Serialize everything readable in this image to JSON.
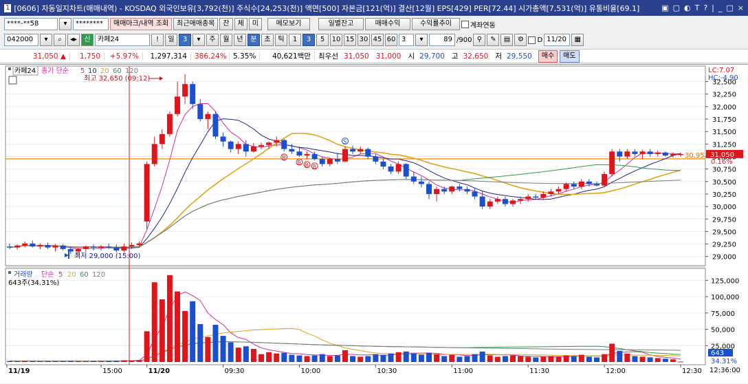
{
  "window": {
    "number": "1",
    "title": "[0606] 자동일지차트(매매내역) - KOSDAQ 외국인보유[3,792(천)] 주식수[24,253(천)] 액면[500] 자본금[121(억)] 결산[12월] EPS[429] PER[72.44] 시가총액[7,531(억)] 유통비율[69.1]",
    "controls": [
      "▣",
      "▢",
      "◐",
      "T",
      "?",
      "|",
      "_",
      "□",
      "×"
    ]
  },
  "toolbar1": {
    "account": "****-**58",
    "password": "********",
    "mark_button": "매매마크/내역 조회",
    "recent_button": "최근매매종목",
    "jan": "잔",
    "che": "체",
    "mi": "미",
    "memo_button": "메모보기",
    "daily_balance_button": "일별잔고",
    "trade_profit_button": "매매수익",
    "profit_trend_button": "수익률추이",
    "account_link_label": "계좌연동"
  },
  "toolbar2": {
    "code": "042000",
    "sin_badge": "신",
    "stock_name": "카페24",
    "excl": "!",
    "period_day": "일",
    "day_count": "3",
    "week": "주",
    "month": "월",
    "year": "년",
    "minute": "분",
    "tick": "초",
    "tick2": "틱",
    "intervals": [
      "1",
      "3",
      "5",
      "10",
      "15",
      "30",
      "45",
      "60"
    ],
    "interval_selected": "3",
    "interval_value": "3",
    "count_value": "89",
    "count_total": "/900",
    "d_label": "D",
    "date_value": "11/20"
  },
  "quote": {
    "price": "31,050",
    "arrow": "▲",
    "change": "1,750",
    "change_pct": "+5.97%",
    "volume": "1,297,314",
    "vol_ratio": "386.24%",
    "turnover": "5.35%",
    "amount": "40,621백만",
    "best_label": "최우선",
    "ask": "31,050",
    "bid": "31,000",
    "open_label": "시",
    "open": "29,700",
    "high_label": "고",
    "high": "32,650",
    "low_label": "저",
    "low": "29,550",
    "buy_button": "매수",
    "sell_button": "매도"
  },
  "price_panel": {
    "stock_label": "카페24",
    "ma_title": "종가 단순",
    "ma_periods": [
      "5",
      "10",
      "20",
      "60",
      "120"
    ],
    "ma_colors": [
      "#d0309a",
      "#23238c",
      "#e0a418",
      "#2e9a4e",
      "#7a7a7a"
    ],
    "lc_label": "LC:7.07",
    "hc_label": "HC:-4.90",
    "high_annotation": "최고 32,650 (09:12)",
    "low_annotation": "최저 29,000 (15:00)",
    "y_ticks": [
      "32,500",
      "32,250",
      "32,000",
      "31,750",
      "31,500",
      "31,250",
      "31,000",
      "30,750",
      "30,500",
      "30,250",
      "30,000",
      "29,750",
      "29,500",
      "29,250",
      "29,000"
    ],
    "ref_price_label": "30,953",
    "current_price_label": "31,050",
    "pct_label": "0.16%"
  },
  "volume_panel": {
    "title": "거래량",
    "ma_title": "단순",
    "ma_periods": [
      "5",
      "20",
      "60",
      "120"
    ],
    "current_label": "643주(34.31%)",
    "y_ticks": [
      "125,000",
      "100,000",
      "75,000",
      "50,000",
      "25,000"
    ],
    "current_value": "643",
    "current_pct": "34.31%"
  },
  "x_axis": {
    "labels": [
      "11/19",
      "15:00",
      "11/20",
      "09:30",
      "10:00",
      "10:30",
      "11:00",
      "11:30",
      "12:00",
      "12:30"
    ],
    "end_time": "12:36:00"
  },
  "colors": {
    "up": "#e0151b",
    "down": "#1a4fcf",
    "title_bar": "#2b3f8f",
    "ref_line": "#f08a00"
  },
  "chart_data": {
    "type": "candlestick",
    "price_ylim": [
      28900,
      32700
    ],
    "volume_ylim": [
      0,
      137000
    ],
    "candles": [
      {
        "o": 29200,
        "h": 29260,
        "l": 29150,
        "c": 29180,
        "v": 1500
      },
      {
        "o": 29180,
        "h": 29240,
        "l": 29140,
        "c": 29220,
        "v": 1200
      },
      {
        "o": 29220,
        "h": 29300,
        "l": 29180,
        "c": 29260,
        "v": 1800
      },
      {
        "o": 29260,
        "h": 29320,
        "l": 29180,
        "c": 29200,
        "v": 1300
      },
      {
        "o": 29200,
        "h": 29260,
        "l": 29150,
        "c": 29230,
        "v": 1100
      },
      {
        "o": 29230,
        "h": 29280,
        "l": 29150,
        "c": 29180,
        "v": 1500
      },
      {
        "o": 29180,
        "h": 29250,
        "l": 29100,
        "c": 29220,
        "v": 1200
      },
      {
        "o": 29220,
        "h": 29250,
        "l": 29120,
        "c": 29150,
        "v": 1400
      },
      {
        "o": 29150,
        "h": 29200,
        "l": 29050,
        "c": 29100,
        "v": 1600
      },
      {
        "o": 29100,
        "h": 29180,
        "l": 29000,
        "c": 29150,
        "v": 1300
      },
      {
        "o": 29150,
        "h": 29220,
        "l": 29100,
        "c": 29200,
        "v": 1200
      },
      {
        "o": 29200,
        "h": 29240,
        "l": 29120,
        "c": 29180,
        "v": 1400
      },
      {
        "o": 29180,
        "h": 29230,
        "l": 29120,
        "c": 29200,
        "v": 1500
      },
      {
        "o": 29200,
        "h": 29260,
        "l": 29150,
        "c": 29180,
        "v": 1700
      },
      {
        "o": 29180,
        "h": 29240,
        "l": 29080,
        "c": 29120,
        "v": 1900
      },
      {
        "o": 29120,
        "h": 29260,
        "l": 29080,
        "c": 29200,
        "v": 2600
      },
      {
        "o": 29200,
        "h": 29280,
        "l": 29150,
        "c": 29230,
        "v": 2300
      },
      {
        "o": 29230,
        "h": 29300,
        "l": 29180,
        "c": 29260,
        "v": 3000
      },
      {
        "o": 29700,
        "h": 30900,
        "l": 29550,
        "c": 30850,
        "v": 47000
      },
      {
        "o": 30850,
        "h": 31400,
        "l": 30800,
        "c": 31250,
        "v": 122000
      },
      {
        "o": 31250,
        "h": 31550,
        "l": 31150,
        "c": 31450,
        "v": 96000
      },
      {
        "o": 31450,
        "h": 31900,
        "l": 31400,
        "c": 31850,
        "v": 133000
      },
      {
        "o": 31850,
        "h": 32500,
        "l": 31800,
        "c": 32200,
        "v": 108000
      },
      {
        "o": 32200,
        "h": 32650,
        "l": 32050,
        "c": 32450,
        "v": 78000
      },
      {
        "o": 32450,
        "h": 32500,
        "l": 31950,
        "c": 32050,
        "v": 93000
      },
      {
        "o": 32050,
        "h": 32150,
        "l": 31700,
        "c": 31750,
        "v": 58000
      },
      {
        "o": 31750,
        "h": 31900,
        "l": 31550,
        "c": 31850,
        "v": 38000
      },
      {
        "o": 31850,
        "h": 31900,
        "l": 31350,
        "c": 31400,
        "v": 57000
      },
      {
        "o": 31400,
        "h": 31480,
        "l": 31200,
        "c": 31300,
        "v": 40000
      },
      {
        "o": 31300,
        "h": 31320,
        "l": 31080,
        "c": 31150,
        "v": 30000
      },
      {
        "o": 31150,
        "h": 31300,
        "l": 31050,
        "c": 31250,
        "v": 22000
      },
      {
        "o": 31250,
        "h": 31330,
        "l": 31000,
        "c": 31100,
        "v": 24000
      },
      {
        "o": 31100,
        "h": 31270,
        "l": 31080,
        "c": 31200,
        "v": 20000
      },
      {
        "o": 31200,
        "h": 31280,
        "l": 31150,
        "c": 31230,
        "v": 12000
      },
      {
        "o": 31230,
        "h": 31300,
        "l": 31150,
        "c": 31280,
        "v": 15000
      },
      {
        "o": 31280,
        "h": 31400,
        "l": 31200,
        "c": 31330,
        "v": 13000
      },
      {
        "o": 31330,
        "h": 31350,
        "l": 31100,
        "c": 31150,
        "v": 14000
      },
      {
        "o": 31150,
        "h": 31250,
        "l": 31050,
        "c": 31100,
        "v": 11000
      },
      {
        "o": 31100,
        "h": 31200,
        "l": 31000,
        "c": 31020,
        "v": 10000
      },
      {
        "o": 31020,
        "h": 31100,
        "l": 30950,
        "c": 31050,
        "v": 9000
      },
      {
        "o": 31050,
        "h": 31100,
        "l": 30920,
        "c": 30950,
        "v": 10000
      },
      {
        "o": 30950,
        "h": 31000,
        "l": 30800,
        "c": 30850,
        "v": 12000
      },
      {
        "o": 30850,
        "h": 30980,
        "l": 30800,
        "c": 30950,
        "v": 9000
      },
      {
        "o": 30950,
        "h": 31080,
        "l": 30850,
        "c": 30900,
        "v": 10000
      },
      {
        "o": 30900,
        "h": 31200,
        "l": 30880,
        "c": 31150,
        "v": 18000
      },
      {
        "o": 31150,
        "h": 31220,
        "l": 31050,
        "c": 31100,
        "v": 9000
      },
      {
        "o": 31100,
        "h": 31200,
        "l": 31050,
        "c": 31150,
        "v": 8000
      },
      {
        "o": 31150,
        "h": 31180,
        "l": 30950,
        "c": 31000,
        "v": 9000
      },
      {
        "o": 31000,
        "h": 31050,
        "l": 30850,
        "c": 30900,
        "v": 12000
      },
      {
        "o": 30900,
        "h": 30950,
        "l": 30750,
        "c": 30800,
        "v": 11000
      },
      {
        "o": 30800,
        "h": 30850,
        "l": 30650,
        "c": 30700,
        "v": 13000
      },
      {
        "o": 30700,
        "h": 30900,
        "l": 30650,
        "c": 30850,
        "v": 15000
      },
      {
        "o": 30850,
        "h": 30870,
        "l": 30550,
        "c": 30600,
        "v": 16000
      },
      {
        "o": 30600,
        "h": 30700,
        "l": 30450,
        "c": 30500,
        "v": 13000
      },
      {
        "o": 30500,
        "h": 30600,
        "l": 30380,
        "c": 30450,
        "v": 11000
      },
      {
        "o": 30450,
        "h": 30500,
        "l": 30150,
        "c": 30250,
        "v": 14000
      },
      {
        "o": 30250,
        "h": 30400,
        "l": 30100,
        "c": 30350,
        "v": 12000
      },
      {
        "o": 30350,
        "h": 30400,
        "l": 30250,
        "c": 30300,
        "v": 9000
      },
      {
        "o": 30300,
        "h": 30420,
        "l": 30250,
        "c": 30400,
        "v": 11000
      },
      {
        "o": 30400,
        "h": 30450,
        "l": 30300,
        "c": 30350,
        "v": 8000
      },
      {
        "o": 30350,
        "h": 30400,
        "l": 30250,
        "c": 30300,
        "v": 9000
      },
      {
        "o": 30300,
        "h": 30380,
        "l": 30150,
        "c": 30200,
        "v": 12000
      },
      {
        "o": 30200,
        "h": 30300,
        "l": 29950,
        "c": 30000,
        "v": 16000
      },
      {
        "o": 30000,
        "h": 30150,
        "l": 29950,
        "c": 30100,
        "v": 10000
      },
      {
        "o": 30100,
        "h": 30200,
        "l": 30050,
        "c": 30150,
        "v": 8000
      },
      {
        "o": 30150,
        "h": 30200,
        "l": 30000,
        "c": 30050,
        "v": 9000
      },
      {
        "o": 30050,
        "h": 30150,
        "l": 30000,
        "c": 30120,
        "v": 10000
      },
      {
        "o": 30120,
        "h": 30200,
        "l": 30050,
        "c": 30150,
        "v": 9000
      },
      {
        "o": 30150,
        "h": 30250,
        "l": 30100,
        "c": 30200,
        "v": 8000
      },
      {
        "o": 30200,
        "h": 30250,
        "l": 30150,
        "c": 30180,
        "v": 7000
      },
      {
        "o": 30180,
        "h": 30300,
        "l": 30150,
        "c": 30250,
        "v": 8000
      },
      {
        "o": 30250,
        "h": 30350,
        "l": 30200,
        "c": 30300,
        "v": 9000
      },
      {
        "o": 30300,
        "h": 30400,
        "l": 30250,
        "c": 30350,
        "v": 8000
      },
      {
        "o": 30350,
        "h": 30480,
        "l": 30300,
        "c": 30450,
        "v": 10000
      },
      {
        "o": 30450,
        "h": 30500,
        "l": 30350,
        "c": 30400,
        "v": 9000
      },
      {
        "o": 30400,
        "h": 30550,
        "l": 30350,
        "c": 30500,
        "v": 11000
      },
      {
        "o": 30500,
        "h": 30550,
        "l": 30400,
        "c": 30450,
        "v": 8000
      },
      {
        "o": 30450,
        "h": 30500,
        "l": 30400,
        "c": 30420,
        "v": 7000
      },
      {
        "o": 30420,
        "h": 30700,
        "l": 30400,
        "c": 30650,
        "v": 12000
      },
      {
        "o": 30650,
        "h": 31150,
        "l": 30600,
        "c": 31100,
        "v": 28000
      },
      {
        "o": 31100,
        "h": 31150,
        "l": 30900,
        "c": 31000,
        "v": 17000
      },
      {
        "o": 31000,
        "h": 31150,
        "l": 30950,
        "c": 31100,
        "v": 13000
      },
      {
        "o": 31100,
        "h": 31150,
        "l": 31000,
        "c": 31050,
        "v": 9000
      },
      {
        "o": 31050,
        "h": 31130,
        "l": 30950,
        "c": 31100,
        "v": 8000
      },
      {
        "o": 31100,
        "h": 31150,
        "l": 31000,
        "c": 31050,
        "v": 7000
      },
      {
        "o": 31050,
        "h": 31120,
        "l": 31000,
        "c": 31080,
        "v": 6000
      },
      {
        "o": 31080,
        "h": 31100,
        "l": 31000,
        "c": 31020,
        "v": 5000
      },
      {
        "o": 31020,
        "h": 31080,
        "l": 30980,
        "c": 31050,
        "v": 4000
      },
      {
        "o": 31050,
        "h": 31080,
        "l": 31000,
        "c": 31050,
        "v": 643
      }
    ]
  }
}
